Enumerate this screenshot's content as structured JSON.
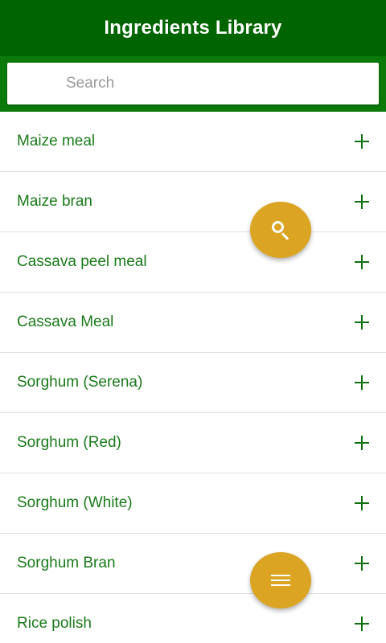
{
  "header": {
    "title": "Ingredients Library"
  },
  "search": {
    "placeholder": "Search",
    "value": ""
  },
  "ingredients": [
    {
      "name": "Maize meal",
      "action_icon": "plus-icon"
    },
    {
      "name": "Maize bran",
      "action_icon": "plus-icon"
    },
    {
      "name": "Cassava peel meal",
      "action_icon": "plus-icon"
    },
    {
      "name": "Cassava Meal",
      "action_icon": "plus-icon"
    },
    {
      "name": "Sorghum (Serena)",
      "action_icon": "plus-icon"
    },
    {
      "name": "Sorghum (Red)",
      "action_icon": "plus-icon"
    },
    {
      "name": "Sorghum (White)",
      "action_icon": "plus-icon"
    },
    {
      "name": "Sorghum Bran",
      "action_icon": "plus-icon"
    },
    {
      "name": "Rice polish",
      "action_icon": "plus-icon"
    }
  ],
  "fabs": {
    "search": {
      "icon": "search-icon"
    },
    "menu": {
      "icon": "menu-icon"
    }
  },
  "colors": {
    "header_bg": "#006400",
    "search_bar_bg": "#0b7a0b",
    "item_text": "#1a7a1a",
    "fab_bg": "#dba523"
  }
}
